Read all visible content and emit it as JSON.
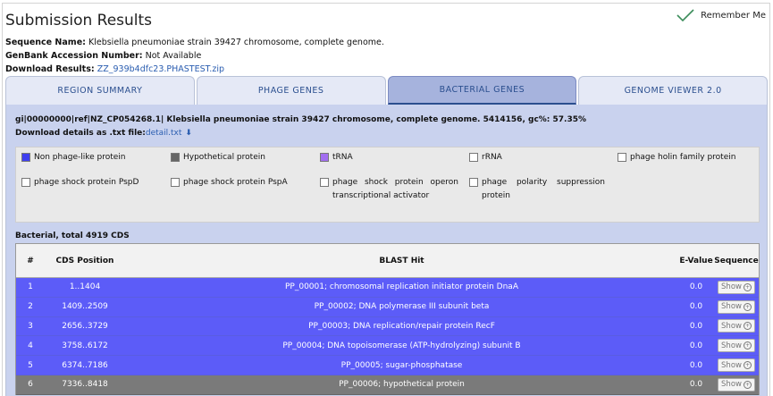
{
  "header": {
    "title": "Submission Results",
    "remember_label": "Remember Me"
  },
  "meta": {
    "sequence_name_label": "Sequence Name:",
    "sequence_name": "Klebsiella pneumoniae strain 39427 chromosome, complete genome.",
    "genbank_label": "GenBank Accession Number:",
    "genbank_value": "Not Available",
    "download_label": "Download Results:",
    "download_link": "ZZ_939b4dfc23.PHASTEST.zip"
  },
  "tabs": [
    {
      "label": "REGION SUMMARY"
    },
    {
      "label": "PHAGE GENES"
    },
    {
      "label": "BACTERIAL GENES"
    },
    {
      "label": "GENOME VIEWER 2.0"
    }
  ],
  "panel": {
    "genome_line": "gi|00000000|ref|NZ_CP054268.1| Klebsiella pneumoniae strain 39427 chromosome, complete genome. 5414156, gc%: 57.35%",
    "download_prefix": "Download details as .txt file:",
    "download_file": "detail.txt",
    "download_icon": "⬇"
  },
  "legend": [
    {
      "label": "Non phage-like protein",
      "color": "#3f3ff0"
    },
    {
      "label": "Hypothetical protein",
      "color": "#777777"
    },
    {
      "label": "tRNA",
      "color": "#a26ef0"
    },
    {
      "label": "rRNA",
      "color": "#ffffff"
    },
    {
      "label": "phage holin family protein",
      "color": "#ffffff"
    },
    {
      "label": "phage shock protein PspD",
      "color": "#ffffff"
    },
    {
      "label": "phage shock protein PspA",
      "color": "#ffffff"
    },
    {
      "label": "phage shock protein operon transcriptional activator",
      "color": "#ffffff"
    },
    {
      "label": "phage polarity suppression protein",
      "color": "#ffffff"
    }
  ],
  "table": {
    "caption": "Bacterial, total 4919 CDS",
    "headers": {
      "num": "#",
      "pos": "CDS Position",
      "hit": "BLAST Hit",
      "eval": "E-Value",
      "seq": "Sequence"
    },
    "show_label": "Show",
    "rows": [
      {
        "num": "1",
        "pos": "1..1404",
        "hit": "PP_00001; chromosomal replication initiator protein DnaA",
        "eval": "0.0",
        "type": "phage-like"
      },
      {
        "num": "2",
        "pos": "1409..2509",
        "hit": "PP_00002; DNA polymerase III subunit beta",
        "eval": "0.0",
        "type": "phage-like"
      },
      {
        "num": "3",
        "pos": "2656..3729",
        "hit": "PP_00003; DNA replication/repair protein RecF",
        "eval": "0.0",
        "type": "phage-like"
      },
      {
        "num": "4",
        "pos": "3758..6172",
        "hit": "PP_00004; DNA topoisomerase (ATP-hydrolyzing) subunit B",
        "eval": "0.0",
        "type": "phage-like"
      },
      {
        "num": "5",
        "pos": "6374..7186",
        "hit": "PP_00005; sugar-phosphatase",
        "eval": "0.0",
        "type": "phage-like"
      },
      {
        "num": "6",
        "pos": "7336..8418",
        "hit": "PP_00006; hypothetical protein",
        "eval": "0.0",
        "type": "hypothetical"
      }
    ]
  }
}
